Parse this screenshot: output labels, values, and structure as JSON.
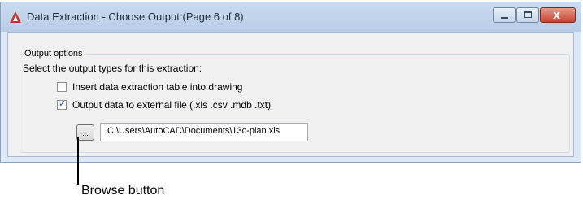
{
  "window": {
    "title": "Data Extraction - Choose Output (Page 6 of 8)",
    "app_icon": "autocad-icon",
    "caption_buttons": {
      "minimize": "minimize-icon",
      "maximize": "maximize-icon",
      "close_glyph": "x"
    }
  },
  "output_options": {
    "group_label": "Output options",
    "prompt": "Select the output types for this extraction:",
    "options": [
      {
        "label": "Insert data extraction table into drawing",
        "checked": false
      },
      {
        "label": "Output data to external file (.xls .csv .mdb .txt)",
        "checked": true
      }
    ],
    "browse_label": "...",
    "file_path": "C:\\Users\\AutoCAD\\Documents\\13c-plan.xls"
  },
  "annotation": {
    "callout_text": "Browse button"
  },
  "colors": {
    "accent": "#c9452f",
    "titlebar": "#c9dbef",
    "client_bg": "#f0f0f0"
  }
}
